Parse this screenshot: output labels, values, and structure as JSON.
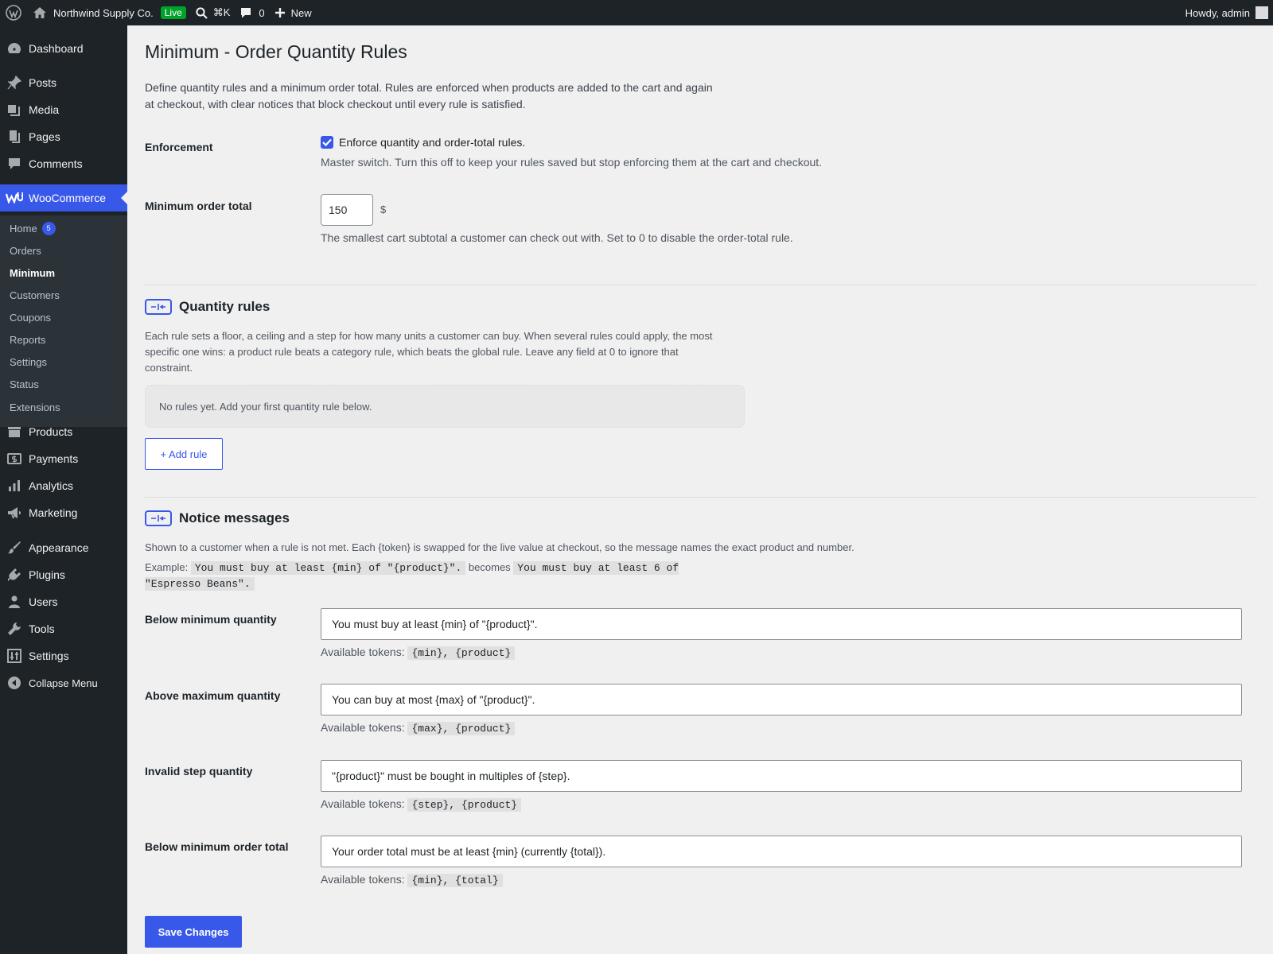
{
  "admin_bar": {
    "site_name": "Northwind Supply Co.",
    "live_badge": "Live",
    "search_shortcut": "⌘K",
    "comments_count": "0",
    "new_label": "New",
    "greeting": "Howdy, admin"
  },
  "sidebar": {
    "dashboard": "Dashboard",
    "posts": "Posts",
    "media": "Media",
    "pages": "Pages",
    "comments": "Comments",
    "woocommerce": "WooCommerce",
    "woo_sub": {
      "home": "Home",
      "home_badge": "5",
      "orders": "Orders",
      "minimum": "Minimum",
      "customers": "Customers",
      "coupons": "Coupons",
      "reports": "Reports",
      "settings": "Settings",
      "status": "Status",
      "extensions": "Extensions"
    },
    "products": "Products",
    "payments": "Payments",
    "analytics": "Analytics",
    "marketing": "Marketing",
    "appearance": "Appearance",
    "plugins": "Plugins",
    "users": "Users",
    "tools": "Tools",
    "settings": "Settings",
    "collapse": "Collapse Menu"
  },
  "page": {
    "title": "Minimum - Order Quantity Rules",
    "intro": "Define quantity rules and a minimum order total. Rules are enforced when products are added to the cart and again at checkout, with clear notices that block checkout until every rule is satisfied."
  },
  "enforcement": {
    "label": "Enforcement",
    "checkbox_label": "Enforce quantity and order-total rules.",
    "checked": true,
    "description": "Master switch. Turn this off to keep your rules saved but stop enforcing them at the cart and checkout."
  },
  "minimum_total": {
    "label": "Minimum order total",
    "value": "150",
    "currency": "$",
    "description": "The smallest cart subtotal a customer can check out with. Set to 0 to disable the order-total rule."
  },
  "quantity_rules": {
    "title": "Quantity rules",
    "description": "Each rule sets a floor, a ceiling and a step for how many units a customer can buy. When several rules could apply, the most specific one wins: a product rule beats a category rule, which beats the global rule. Leave any field at 0 to ignore that constraint.",
    "empty_text": "No rules yet. Add your first quantity rule below.",
    "add_button": "+ Add rule"
  },
  "notices": {
    "title": "Notice messages",
    "description": "Shown to a customer when a rule is not met. Each {token} is swapped for the live value at checkout, so the message names the exact product and number.",
    "example_prefix": "Example:",
    "example_template": "You must buy at least {min} of \"{product}\".",
    "example_joiner": "becomes",
    "example_result": "You must buy at least 6 of \"Espresso Beans\".",
    "tokens_label": "Available tokens:",
    "fields": [
      {
        "label": "Below minimum quantity",
        "value": "You must buy at least {min} of \"{product}\".",
        "tokens": "{min}, {product}"
      },
      {
        "label": "Above maximum quantity",
        "value": "You can buy at most {max} of \"{product}\".",
        "tokens": "{max}, {product}"
      },
      {
        "label": "Invalid step quantity",
        "value": "\"{product}\" must be bought in multiples of {step}.",
        "tokens": "{step}, {product}"
      },
      {
        "label": "Below minimum order total",
        "value": "Your order total must be at least {min} (currently {total}).",
        "tokens": "{min}, {total}"
      }
    ]
  },
  "save_button": "Save Changes",
  "colors": {
    "accent": "#3858e9",
    "admin_dark": "#1d2327",
    "live_green": "#00a32a"
  }
}
